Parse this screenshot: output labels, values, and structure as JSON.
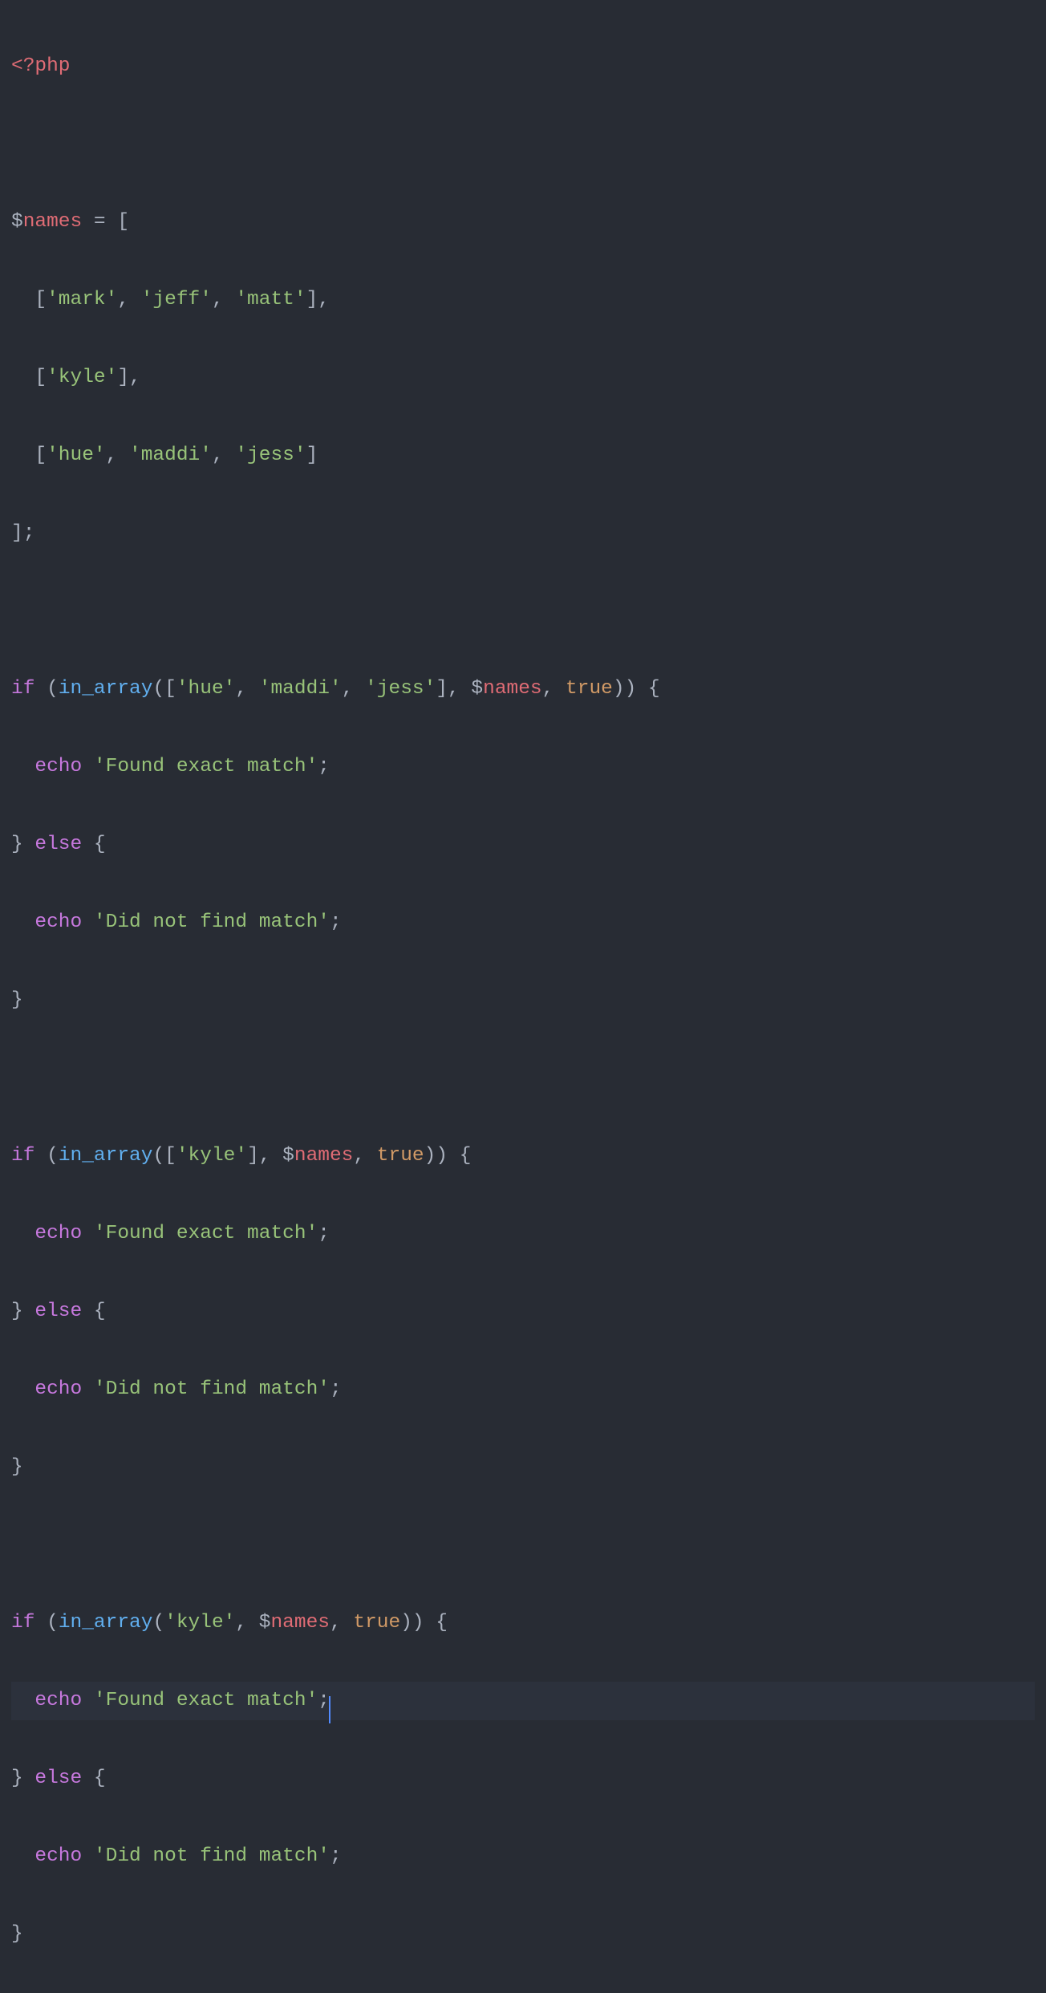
{
  "code": {
    "phpOpen": "<?php",
    "dollar": "$",
    "names": "names",
    "equals": " = ",
    "openBracket": "[",
    "closeBracket": "]",
    "semicolon": ";",
    "comma": ",",
    "commaSpace": ", ",
    "openParen": "(",
    "closeParen": ")",
    "openBrace": " {",
    "closeBrace": "}",
    "indent": "  ",
    "str_mark": "'mark'",
    "str_jeff": "'jeff'",
    "str_matt": "'matt'",
    "str_kyle": "'kyle'",
    "str_hue": "'hue'",
    "str_maddi": "'maddi'",
    "str_jess": "'jess'",
    "if": "if",
    "else": " else",
    "in_array": "in_array",
    "true": "true",
    "echo": "echo",
    "space": " ",
    "str_found": "'Found exact match'",
    "str_notfound": "'Did not find match'"
  }
}
